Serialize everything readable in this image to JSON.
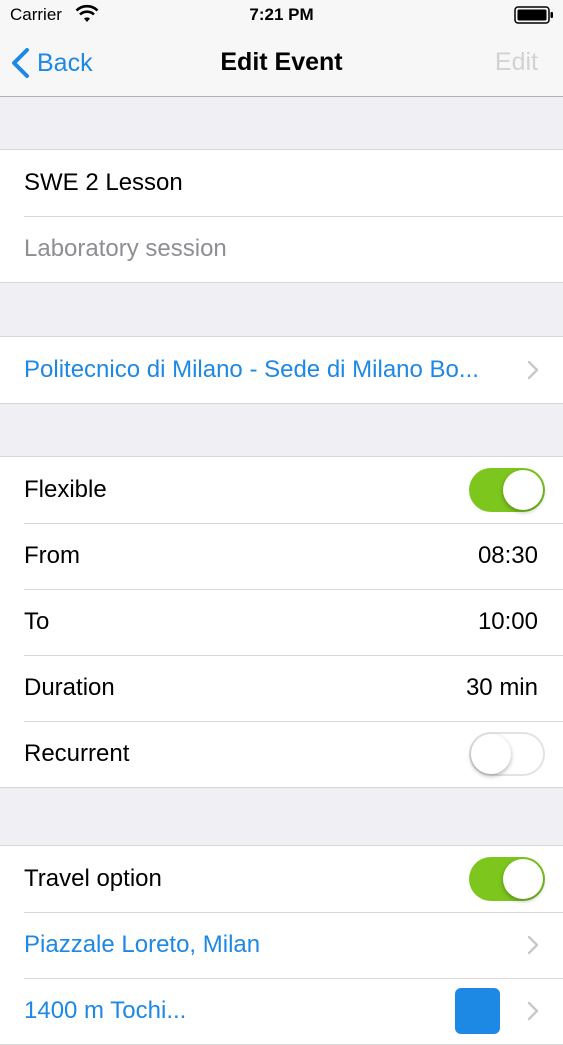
{
  "status_bar": {
    "carrier": "Carrier",
    "time": "7:21 PM"
  },
  "nav": {
    "back_label": "Back",
    "title": "Edit Event",
    "edit_label": "Edit"
  },
  "event": {
    "title": "SWE 2 Lesson",
    "description_placeholder": "Laboratory session"
  },
  "location": {
    "label": "Politecnico di Milano - Sede di Milano Bo..."
  },
  "schedule": {
    "flexible_label": "Flexible",
    "flexible_on": true,
    "from_label": "From",
    "from_value": "08:30",
    "to_label": "To",
    "to_value": "10:00",
    "duration_label": "Duration",
    "duration_value": "30 min",
    "recurrent_label": "Recurrent",
    "recurrent_on": false
  },
  "travel": {
    "option_label": "Travel option",
    "option_on": true,
    "origin": "Piazzale Loreto, Milan",
    "next_row_partial": "1400 m Tochi..."
  },
  "colors": {
    "accent": "#1e88e5",
    "toggle_on": "#7cc61d",
    "background": "#efeff4"
  }
}
